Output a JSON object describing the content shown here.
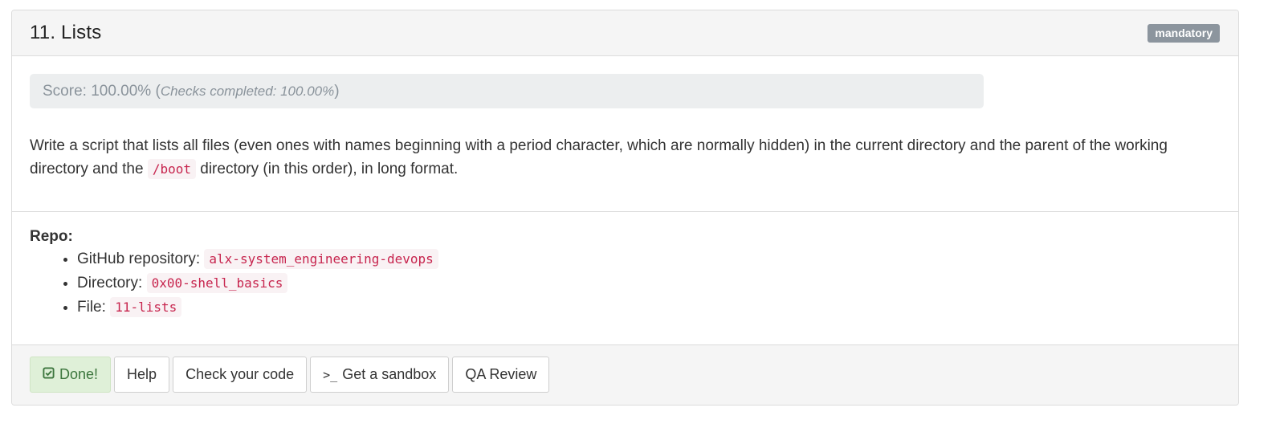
{
  "task": {
    "title": "11. Lists",
    "badge": "mandatory"
  },
  "score": {
    "label": "Score: 100.00%",
    "open_paren": " (",
    "checks": "Checks completed: 100.00%",
    "close_paren": ")"
  },
  "description": {
    "part1": "Write a script that lists all files (even ones with names beginning with a period character, which are normally hidden) in the current directory and the parent of the working directory and the ",
    "code": "/boot",
    "part2": " directory (in this order), in long format."
  },
  "repo": {
    "title": "Repo:",
    "items": [
      {
        "label": "GitHub repository: ",
        "value": "alx-system_engineering-devops"
      },
      {
        "label": "Directory: ",
        "value": "0x00-shell_basics"
      },
      {
        "label": "File: ",
        "value": "11-lists"
      }
    ]
  },
  "buttons": {
    "done": "Done!",
    "done_icon": "check-square-icon",
    "help": "Help",
    "check_code": "Check your code",
    "sandbox_icon": ">_",
    "sandbox": "Get a sandbox",
    "qa_review": "QA Review"
  }
}
